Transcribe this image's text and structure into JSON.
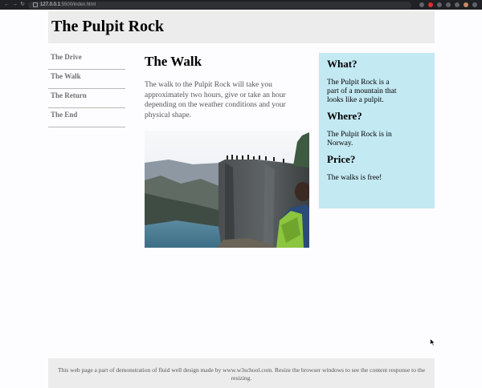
{
  "browser": {
    "url_host": "127.0.0.1",
    "url_path": ":5500/index.html"
  },
  "header": {
    "title": "The Pulpit Rock"
  },
  "menu": {
    "items": [
      {
        "label": "The Drive"
      },
      {
        "label": "The Walk"
      },
      {
        "label": "The Return"
      },
      {
        "label": "The End"
      }
    ]
  },
  "main": {
    "heading": "The Walk",
    "text": "The walk to the Pulpit Rock will take you approximately two hours, give or take an hour depending on the weather conditions and your physical shape."
  },
  "aside": {
    "what_heading": "What?",
    "what_text": "The Pulpit Rock is a part of a mountain that looks like a pulpit.",
    "where_heading": "Where?",
    "where_text": "The Pulpit Rock is in Norway.",
    "price_heading": "Price?",
    "price_text": "The walks is free!"
  },
  "footer": {
    "text": "This web page a part of demonstration of fluid well design made by www.w3school.com. Resize the browser windows to see the content response to the resizing."
  },
  "colors": {
    "header_bg": "#ececec",
    "aside_bg": "#c3e9f3",
    "footer_bg": "#ececec"
  }
}
